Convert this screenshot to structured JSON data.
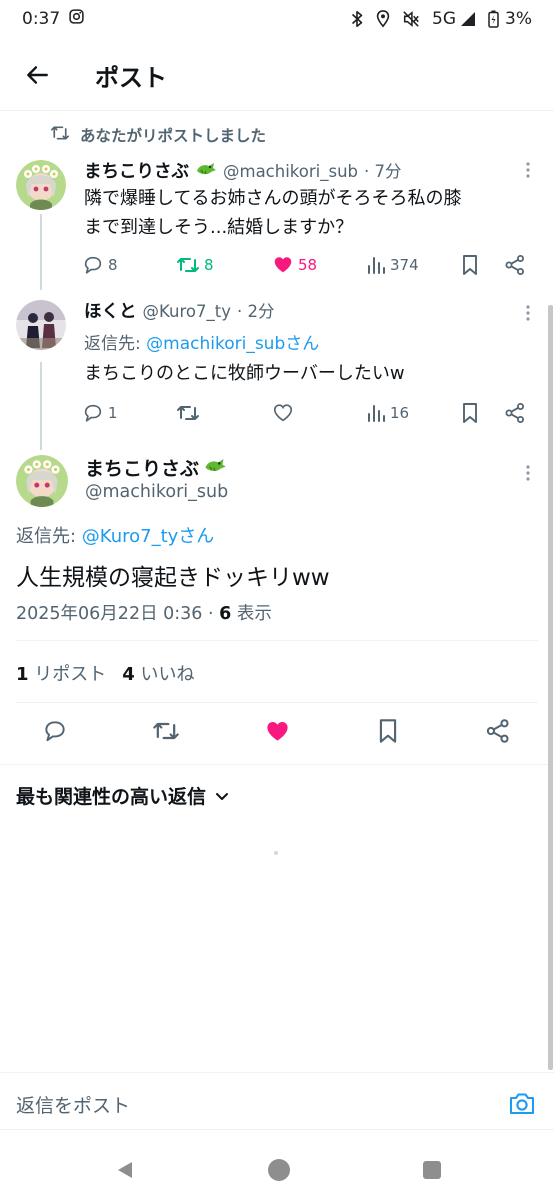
{
  "status_bar": {
    "time": "0:37",
    "network": "5G",
    "battery": "3%"
  },
  "header": {
    "title": "ポスト"
  },
  "repost_banner": {
    "text": "あなたがリポストしました"
  },
  "tweet1": {
    "name": "まちこりさぶ",
    "handle": "@machikori_sub",
    "time": "· 7分",
    "text_line1": "隣で爆睡してるお姉さんの頭がそろそろ私の膝",
    "text_line2": "まで到達しそう...結婚しますか？",
    "replies": "8",
    "reposts": "8",
    "likes": "58",
    "views": "374"
  },
  "tweet2": {
    "name": "ほくと",
    "handle": "@Kuro7_ty",
    "time": "· 2分",
    "reply_prefix": "返信先: ",
    "reply_target": "@machikori_subさん",
    "text": "まちこりのとこに牧師ウーバーしたいw",
    "replies": "1",
    "reposts": "",
    "likes": "",
    "views": "16"
  },
  "main_tweet": {
    "name": "まちこりさぶ",
    "handle": "@machikori_sub",
    "reply_prefix": "返信先: ",
    "reply_target": "@Kuro7_tyさん",
    "text": "人生規模の寝起きドッキリww",
    "datetime": "2025年06月22日 0:36 · ",
    "views_count": "6",
    "views_label": " 表示",
    "repost_count": "1",
    "repost_label": " リポスト",
    "like_count": "4",
    "like_label": " いいね"
  },
  "replies_section": {
    "sort_label": "最も関連性の高い返信"
  },
  "compose": {
    "placeholder": "返信をポスト"
  },
  "colors": {
    "accent": "#1d9bf0",
    "like": "#f91880",
    "repost_active": "#00ba7c",
    "muted": "#536471"
  }
}
